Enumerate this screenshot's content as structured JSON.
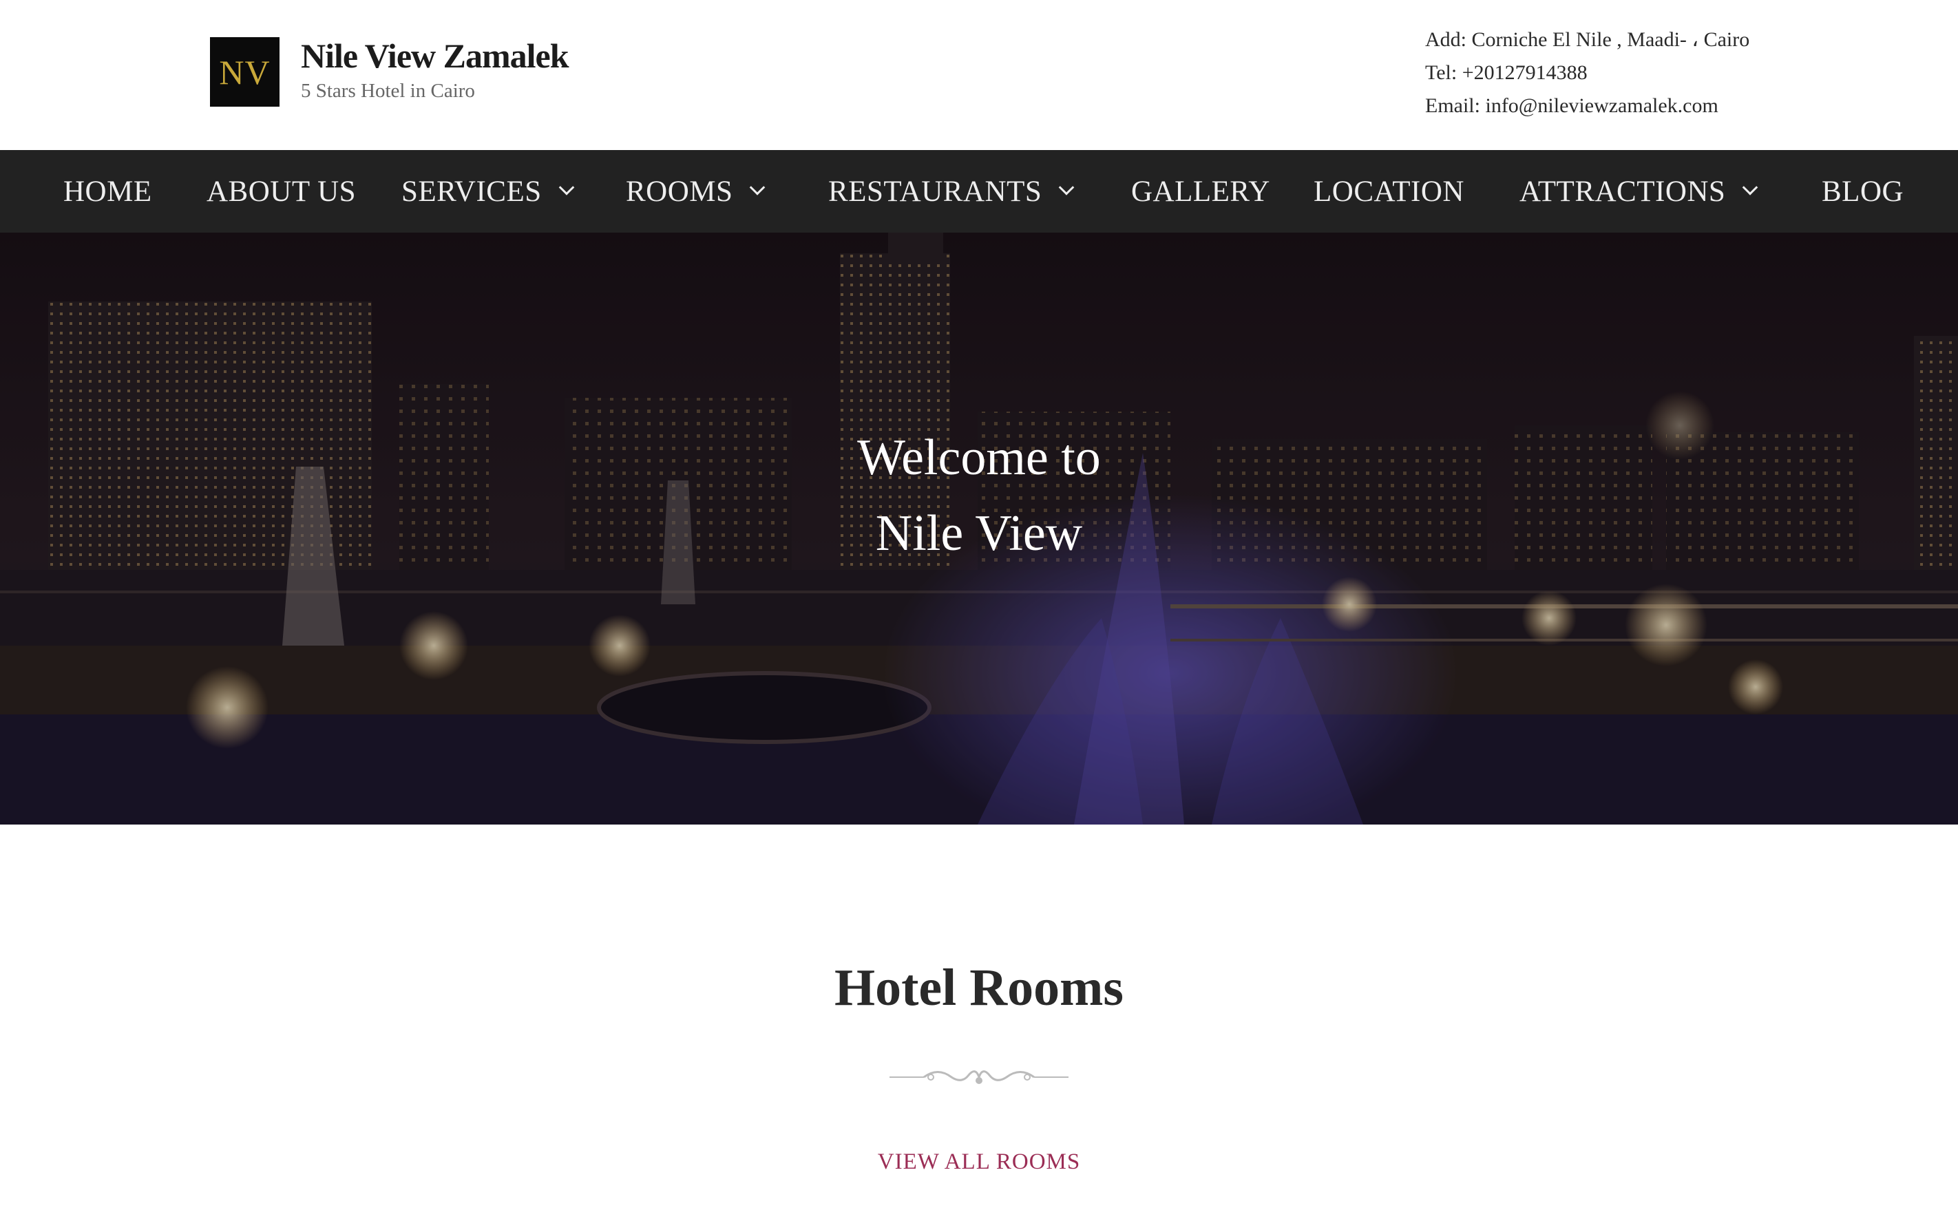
{
  "header": {
    "logo_text": "NV",
    "site_title": "Nile View Zamalek",
    "tagline": "5 Stars Hotel in Cairo",
    "contact": {
      "address": "Add: Corniche El Nile , Maadi- ، Cairo",
      "tel": "Tel: +20127914388",
      "email": "Email: info@nileviewzamalek.com"
    }
  },
  "nav": {
    "items": [
      {
        "label": "HOME",
        "has_dropdown": false
      },
      {
        "label": "ABOUT US",
        "has_dropdown": false
      },
      {
        "label": "SERVICES",
        "has_dropdown": true
      },
      {
        "label": "ROOMS",
        "has_dropdown": true
      },
      {
        "label": "RESTAURANTS",
        "has_dropdown": true
      },
      {
        "label": "GALLERY",
        "has_dropdown": false
      },
      {
        "label": "LOCATION",
        "has_dropdown": false
      },
      {
        "label": "ATTRACTIONS",
        "has_dropdown": true
      },
      {
        "label": "BLOG",
        "has_dropdown": false
      }
    ]
  },
  "hero": {
    "line1": "Welcome to",
    "line2": "Nile View"
  },
  "rooms": {
    "title": "Hotel Rooms",
    "link": "VIEW ALL ROOMS"
  },
  "colors": {
    "nav_bg": "#222222",
    "link_accent": "#9b2d55",
    "logo_gold": "#c9a93a"
  }
}
